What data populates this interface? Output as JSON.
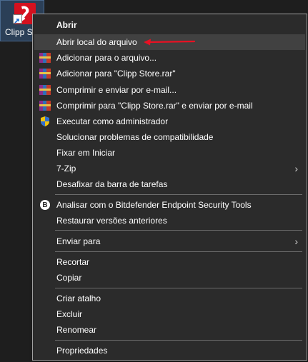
{
  "desktop": {
    "icon_label": "Clipp S",
    "accent_red": "#d4111f"
  },
  "menu": {
    "items": [
      {
        "label": "Abrir",
        "icon": "none",
        "bold": true
      },
      {
        "label": "Abrir local do arquivo",
        "icon": "none",
        "highlight": true
      },
      {
        "label": "Adicionar para o arquivo...",
        "icon": "winrar-icon"
      },
      {
        "label": "Adicionar para \"Clipp Store.rar\"",
        "icon": "winrar-icon"
      },
      {
        "label": "Comprimir e enviar por e-mail...",
        "icon": "winrar-icon"
      },
      {
        "label": "Comprimir para \"Clipp Store.rar\" e enviar por e-mail",
        "icon": "winrar-icon"
      },
      {
        "label": "Executar como administrador",
        "icon": "uac-shield-icon"
      },
      {
        "label": "Solucionar problemas de compatibilidade",
        "icon": "none"
      },
      {
        "label": "Fixar em Iniciar",
        "icon": "none"
      },
      {
        "label": "7-Zip",
        "icon": "none",
        "submenu": true
      },
      {
        "label": "Desafixar da barra de tarefas",
        "icon": "none"
      },
      {
        "label": "Analisar com o Bitdefender Endpoint Security Tools",
        "icon": "bitdefender-icon"
      },
      {
        "label": "Restaurar versões anteriores",
        "icon": "none"
      },
      {
        "label": "Enviar para",
        "icon": "none",
        "submenu": true
      },
      {
        "label": "Recortar",
        "icon": "none"
      },
      {
        "label": "Copiar",
        "icon": "none"
      },
      {
        "label": "Criar atalho",
        "icon": "none"
      },
      {
        "label": "Excluir",
        "icon": "none"
      },
      {
        "label": "Renomear",
        "icon": "none"
      },
      {
        "label": "Propriedades",
        "icon": "none"
      }
    ],
    "bitdefender_glyph": "B",
    "submenu_glyph": "›",
    "highlight_color": "#414141",
    "background": "#2b2b2b"
  },
  "annotation": {
    "arrow_color": "#e81123"
  }
}
